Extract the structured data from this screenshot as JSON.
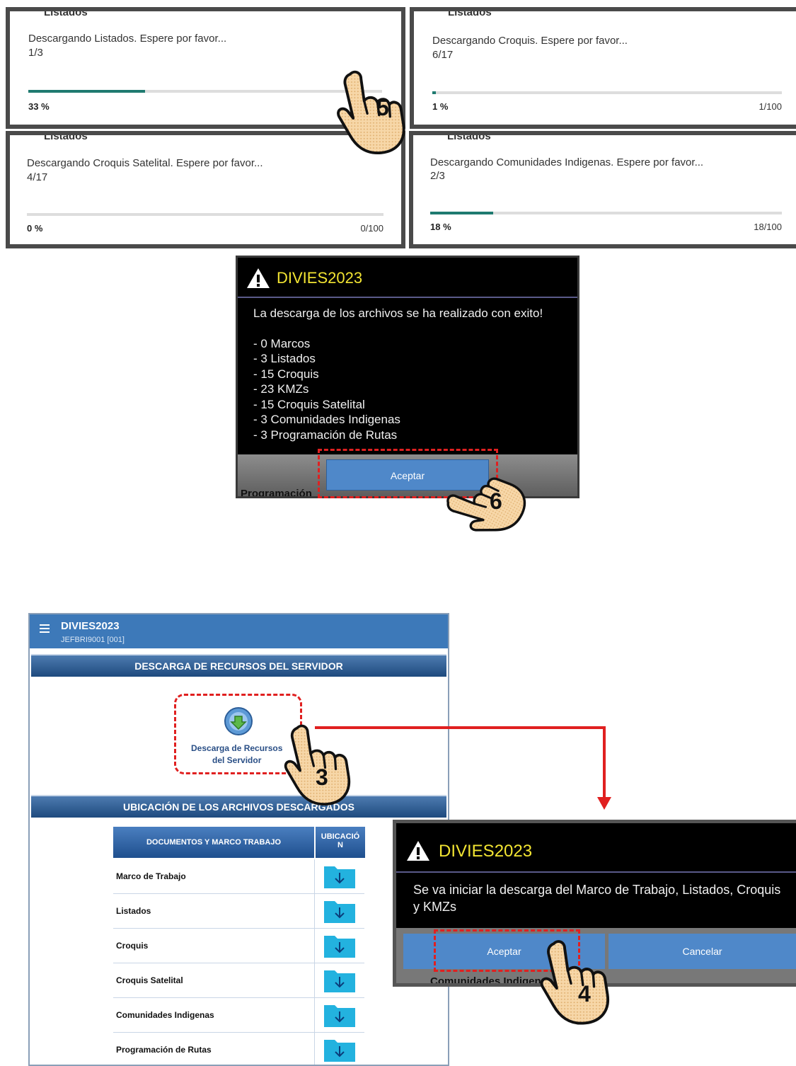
{
  "progress_dialogs": [
    {
      "background_label": "Listados",
      "message": "Descargando Listados. Espere por favor...",
      "step": "1/3",
      "progress": 0.33,
      "percent": "33 %",
      "count": ""
    },
    {
      "background_label": "Listados",
      "message": "Descargando Croquis. Espere por favor...",
      "step": "6/17",
      "progress": 0.01,
      "percent": "1 %",
      "count": "1/100"
    },
    {
      "background_label": "Listados",
      "message": "Descargando Croquis Satelital. Espere por favor...",
      "step": "4/17",
      "progress": 0.0,
      "percent": "0 %",
      "count": "0/100"
    },
    {
      "background_label": "Listados",
      "message": "Descargando Comunidades Indigenas. Espere por favor...",
      "step": "2/3",
      "progress": 0.18,
      "percent": "18 %",
      "count": "18/100"
    }
  ],
  "success_dialog": {
    "title": "DIVIES2023",
    "message": "La descarga de los archivos se ha realizado con exito!",
    "items": [
      "- 0 Marcos",
      "- 3 Listados",
      "- 15 Croquis",
      "- 23 KMZs",
      "- 15 Croquis Satelital",
      "- 3 Comunidades Indigenas",
      "- 3 Programación de Rutas"
    ],
    "button": "Aceptar",
    "background_text": "Programación"
  },
  "app": {
    "title": "DIVIES2023",
    "subtitle": "JEFBRI9001 [001]",
    "section1": "DESCARGA DE RECURSOS DEL SERVIDOR",
    "download_label_line1": "Descarga de Recursos",
    "download_label_line2": "del Servidor",
    "section2": "UBICACIÓN DE LOS ARCHIVOS DESCARGADOS",
    "table_header_doc": "DOCUMENTOS Y MARCO TRABAJO",
    "table_header_loc_line1": "UBICACIÓ",
    "table_header_loc_line2": "N",
    "rows": [
      "Marco de Trabajo",
      "Listados",
      "Croquis",
      "Croquis Satelital",
      "Comunidades Indigenas",
      "Programación de Rutas"
    ]
  },
  "confirm_dialog": {
    "title": "DIVIES2023",
    "message_line1": "Se va iniciar la descarga del Marco de Trabajo, Listados, Croquis",
    "message_line2": "y KMZs",
    "accept": "Aceptar",
    "cancel": "Cancelar",
    "background_text": "Comunidades Indigenas"
  },
  "steps": [
    "5",
    "6",
    "3",
    "4"
  ],
  "colors": {
    "accent": "#3d79b9",
    "progress": "#1f7a70",
    "annotation": "#e02020",
    "alert_title": "#f2e432"
  }
}
